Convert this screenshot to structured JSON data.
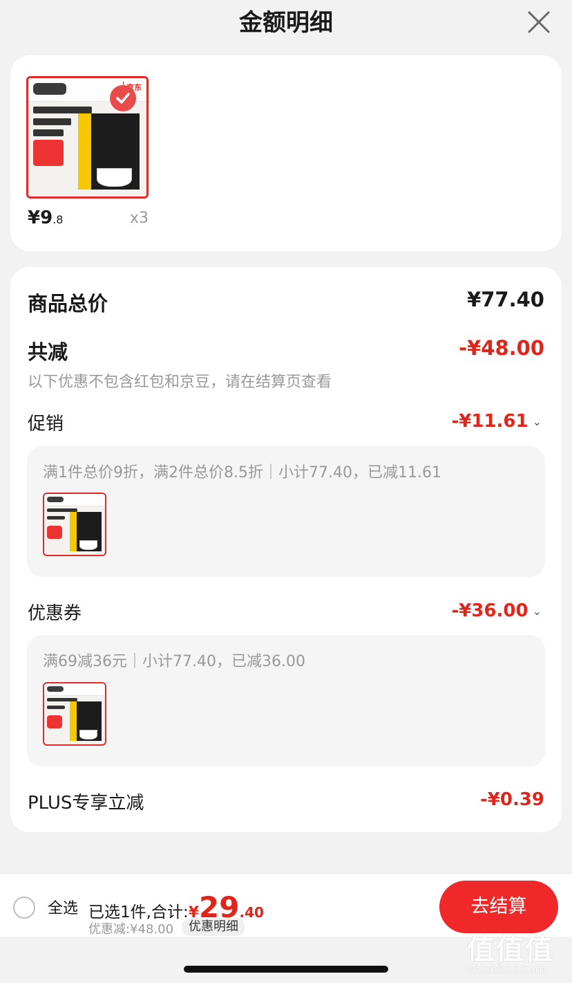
{
  "header": {
    "title": "金额明细",
    "close_icon": "close-icon"
  },
  "product": {
    "image_text": {
      "brand": "京东",
      "name": "白芸豆黑咖啡",
      "count": "20杯",
      "tags": [
        "0脂肪 0蔗糖",
        "碳水阻碍"
      ],
      "promo": "两件8.5折",
      "price_tag": "¥21.9/盒"
    },
    "price_int": "¥9",
    "price_dec": ".8",
    "quantity": "x3"
  },
  "summary": {
    "total_label": "商品总价",
    "total_value": "¥77.40",
    "reduce_label": "共减",
    "reduce_value": "-¥48.00",
    "note": "以下优惠不包含红包和京豆，请在结算页查看"
  },
  "promotion": {
    "label": "促销",
    "value": "-¥11.61",
    "detail": "满1件总价9折，满2件总价8.5折｜小计77.40，已减11.61"
  },
  "coupon": {
    "label": "优惠券",
    "value": "-¥36.00",
    "detail": "满69减36元｜小计77.40，已减36.00"
  },
  "plus": {
    "label": "PLUS专享立减",
    "value": "-¥0.39"
  },
  "bottom": {
    "select_all": "全选",
    "selected_text": "已选1件,合计:",
    "total_currency": "¥",
    "total_int": "29",
    "total_dec": ".40",
    "discount_text": "优惠减:¥48.00",
    "detail_link": "优惠明细",
    "checkout": "去结算"
  },
  "watermark": {
    "logo": "值值值",
    "url": "zhizhizhi.com"
  },
  "colors": {
    "accent": "#e1251b",
    "button": "#f0282a",
    "background": "#f2f2f2"
  }
}
